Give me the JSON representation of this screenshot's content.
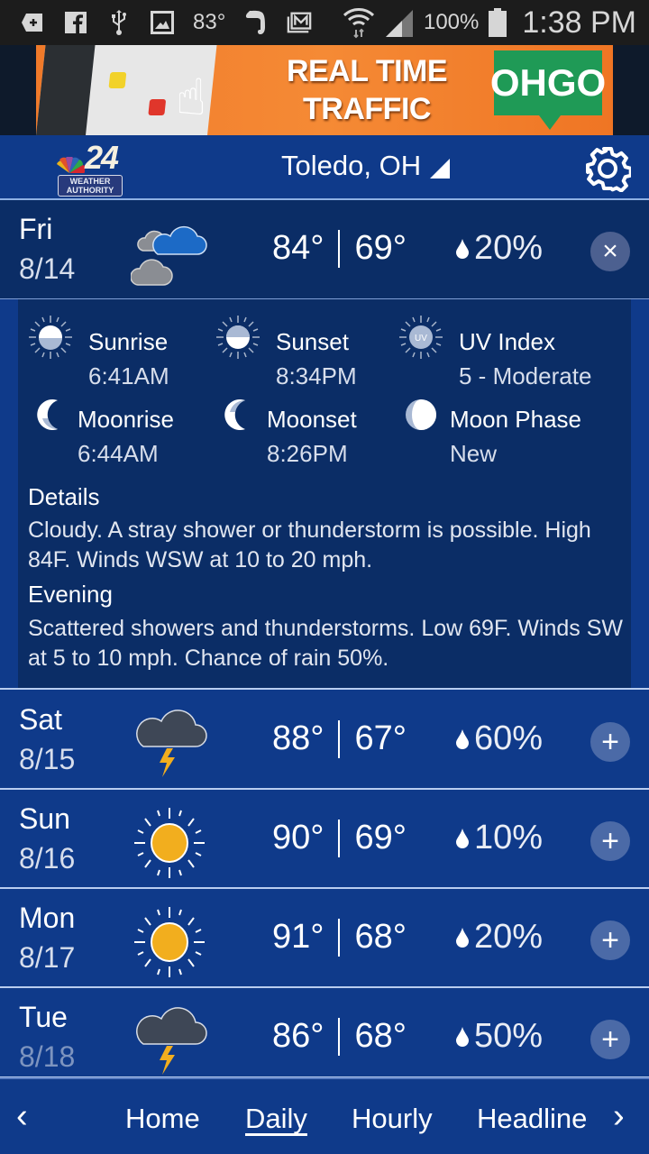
{
  "status_bar": {
    "notification_icons": [
      "flipboard-plus-icon",
      "facebook-icon",
      "usb-icon",
      "gallery-icon",
      "weather-temp",
      "evernote-icon",
      "email-icon"
    ],
    "temperature": "83°",
    "battery": "100%",
    "time": "1:38 PM"
  },
  "ad": {
    "line1": "REAL TIME",
    "line2": "TRAFFIC ALERTS",
    "brand": "OHGO"
  },
  "header": {
    "logo_number": "24",
    "logo_line1": "WEATHER",
    "logo_line2": "AUTHORITY",
    "location": "Toledo, OH"
  },
  "colors": {
    "primary_blue": "#0f3a8a",
    "expanded_navy": "#0b2d66",
    "sun_yellow": "#f2ae1e",
    "storm_cloud": "#3e4756",
    "cloud_blue": "#1c6ac6"
  },
  "days": [
    {
      "name": "Fri",
      "date": "8/14",
      "icon": "cloudy-icon",
      "high": "84°",
      "low": "69°",
      "precip": "20%",
      "expanded": true,
      "toggle": "×"
    },
    {
      "name": "Sat",
      "date": "8/15",
      "icon": "thunderstorm-icon",
      "high": "88°",
      "low": "67°",
      "precip": "60%",
      "expanded": false,
      "toggle": "+"
    },
    {
      "name": "Sun",
      "date": "8/16",
      "icon": "sunny-icon",
      "high": "90°",
      "low": "69°",
      "precip": "10%",
      "expanded": false,
      "toggle": "+"
    },
    {
      "name": "Mon",
      "date": "8/17",
      "icon": "sunny-icon",
      "high": "91°",
      "low": "68°",
      "precip": "20%",
      "expanded": false,
      "toggle": "+"
    },
    {
      "name": "Tue",
      "date": "8/18",
      "icon": "thunderstorm-icon",
      "high": "86°",
      "low": "68°",
      "precip": "50%",
      "expanded": false,
      "toggle": "+"
    }
  ],
  "details": {
    "astro": [
      {
        "label": "Sunrise",
        "value": "6:41AM"
      },
      {
        "label": "Sunset",
        "value": "8:34PM"
      },
      {
        "label": "UV Index",
        "value": "5 - Moderate"
      },
      {
        "label": "Moonrise",
        "value": "6:44AM"
      },
      {
        "label": "Moonset",
        "value": "8:26PM"
      },
      {
        "label": "Moon Phase",
        "value": "New"
      }
    ],
    "details_heading": "Details",
    "details_text": "Cloudy. A stray shower or thunderstorm is possible. High 84F. Winds WSW at 10 to 20 mph.",
    "evening_heading": "Evening",
    "evening_text": "Scattered showers and thunderstorms. Low 69F. Winds SW at 5 to 10 mph. Chance of rain 50%."
  },
  "bottom_nav": {
    "prev": "‹",
    "next": "›",
    "items": [
      "Home",
      "Daily",
      "Hourly",
      "Headline"
    ],
    "active": "Daily"
  }
}
